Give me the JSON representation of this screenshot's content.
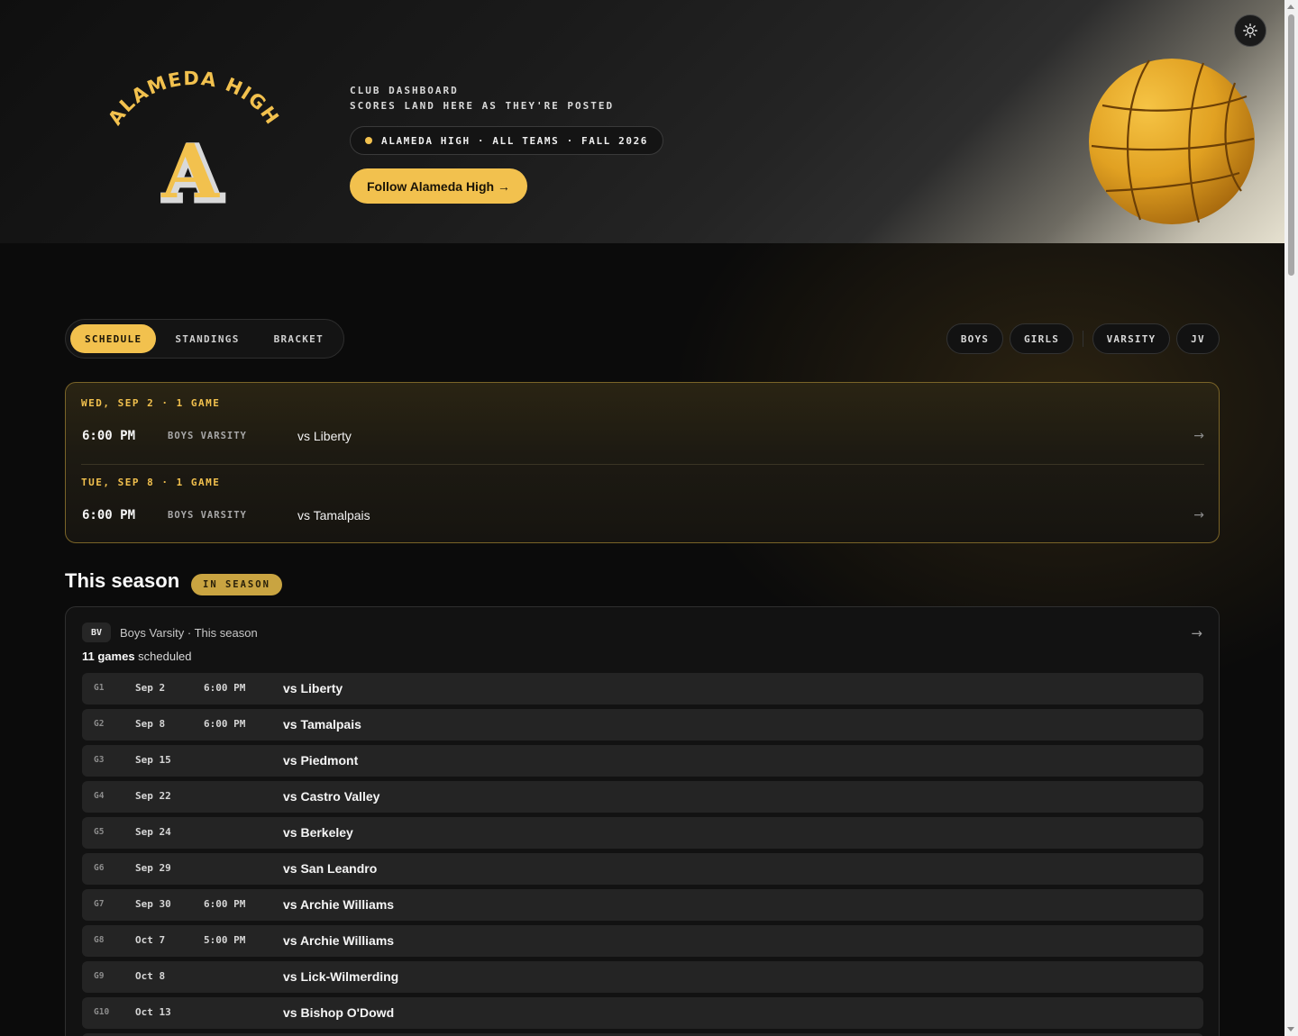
{
  "hero": {
    "logo_arc_text": "ALAMEDA HIGH",
    "logo_letter": "A",
    "eyebrow_line1": "CLUB DASHBOARD",
    "eyebrow_line2": "SCORES LAND HERE AS THEY'RE POSTED",
    "context_pill": "ALAMEDA HIGH · ALL TEAMS · FALL 2026",
    "follow_button": "Follow Alameda High →",
    "ball_icon": "water-polo-ball",
    "theme_toggle_icon": "sun-icon"
  },
  "colors": {
    "accent": "#f2c14e",
    "background": "#0b0b0b",
    "card": "#121212",
    "row": "#242424"
  },
  "tabs": [
    {
      "label": "SCHEDULE",
      "active": true
    },
    {
      "label": "STANDINGS",
      "active": false
    },
    {
      "label": "BRACKET",
      "active": false
    }
  ],
  "filters": [
    "BOYS",
    "GIRLS",
    "VARSITY",
    "JV"
  ],
  "upcoming": [
    {
      "day": "WED, SEP 2 · 1 GAME",
      "time": "6:00 PM",
      "team": "BOYS VARSITY",
      "opponent": "vs Liberty",
      "arrow": "→"
    },
    {
      "day": "TUE, SEP 8 · 1 GAME",
      "time": "6:00 PM",
      "team": "BOYS VARSITY",
      "opponent": "vs Tamalpais",
      "arrow": "→"
    }
  ],
  "season": {
    "title": "This season",
    "badge": "IN SEASON",
    "card": {
      "tag": "BV",
      "heading": "Boys Varsity · This season",
      "arrow": "→",
      "count_number": "11 games",
      "count_text": " scheduled",
      "games": [
        {
          "num": "G1",
          "date": "Sep 2",
          "time": "6:00 PM",
          "opponent": "vs Liberty"
        },
        {
          "num": "G2",
          "date": "Sep 8",
          "time": "6:00 PM",
          "opponent": "vs Tamalpais"
        },
        {
          "num": "G3",
          "date": "Sep 15",
          "time": "",
          "opponent": "vs Piedmont"
        },
        {
          "num": "G4",
          "date": "Sep 22",
          "time": "",
          "opponent": "vs Castro Valley"
        },
        {
          "num": "G5",
          "date": "Sep 24",
          "time": "",
          "opponent": "vs Berkeley"
        },
        {
          "num": "G6",
          "date": "Sep 29",
          "time": "",
          "opponent": "vs San Leandro"
        },
        {
          "num": "G7",
          "date": "Sep 30",
          "time": "6:00 PM",
          "opponent": "vs Archie Williams"
        },
        {
          "num": "G8",
          "date": "Oct 7",
          "time": "5:00 PM",
          "opponent": "vs Archie Williams"
        },
        {
          "num": "G9",
          "date": "Oct 8",
          "time": "",
          "opponent": "vs Lick-Wilmerding"
        },
        {
          "num": "G10",
          "date": "Oct 13",
          "time": "",
          "opponent": "vs Bishop O'Dowd"
        }
      ]
    }
  }
}
